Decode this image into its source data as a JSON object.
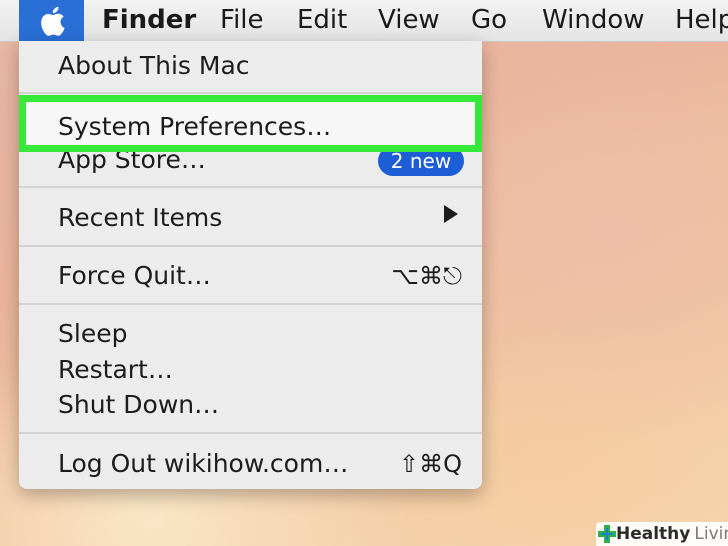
{
  "menubar": {
    "apple_icon": "apple-logo",
    "items": [
      "Finder",
      "File",
      "Edit",
      "View",
      "Go",
      "Window",
      "Help"
    ]
  },
  "apple_menu": {
    "about": "About This Mac",
    "system_preferences": "System Preferences…",
    "app_store": "App Store…",
    "app_store_badge": "2 new",
    "recent_items": "Recent Items",
    "force_quit": "Force Quit…",
    "force_quit_shortcut": "⌥⌘⎋",
    "sleep": "Sleep",
    "restart": "Restart…",
    "shut_down": "Shut Down…",
    "log_out": "Log Out wikihow.com…",
    "log_out_shortcut": "⇧⌘Q"
  },
  "highlight_color": "#35e83a",
  "watermark": {
    "healthy": "Healthy",
    "living": "Living"
  }
}
